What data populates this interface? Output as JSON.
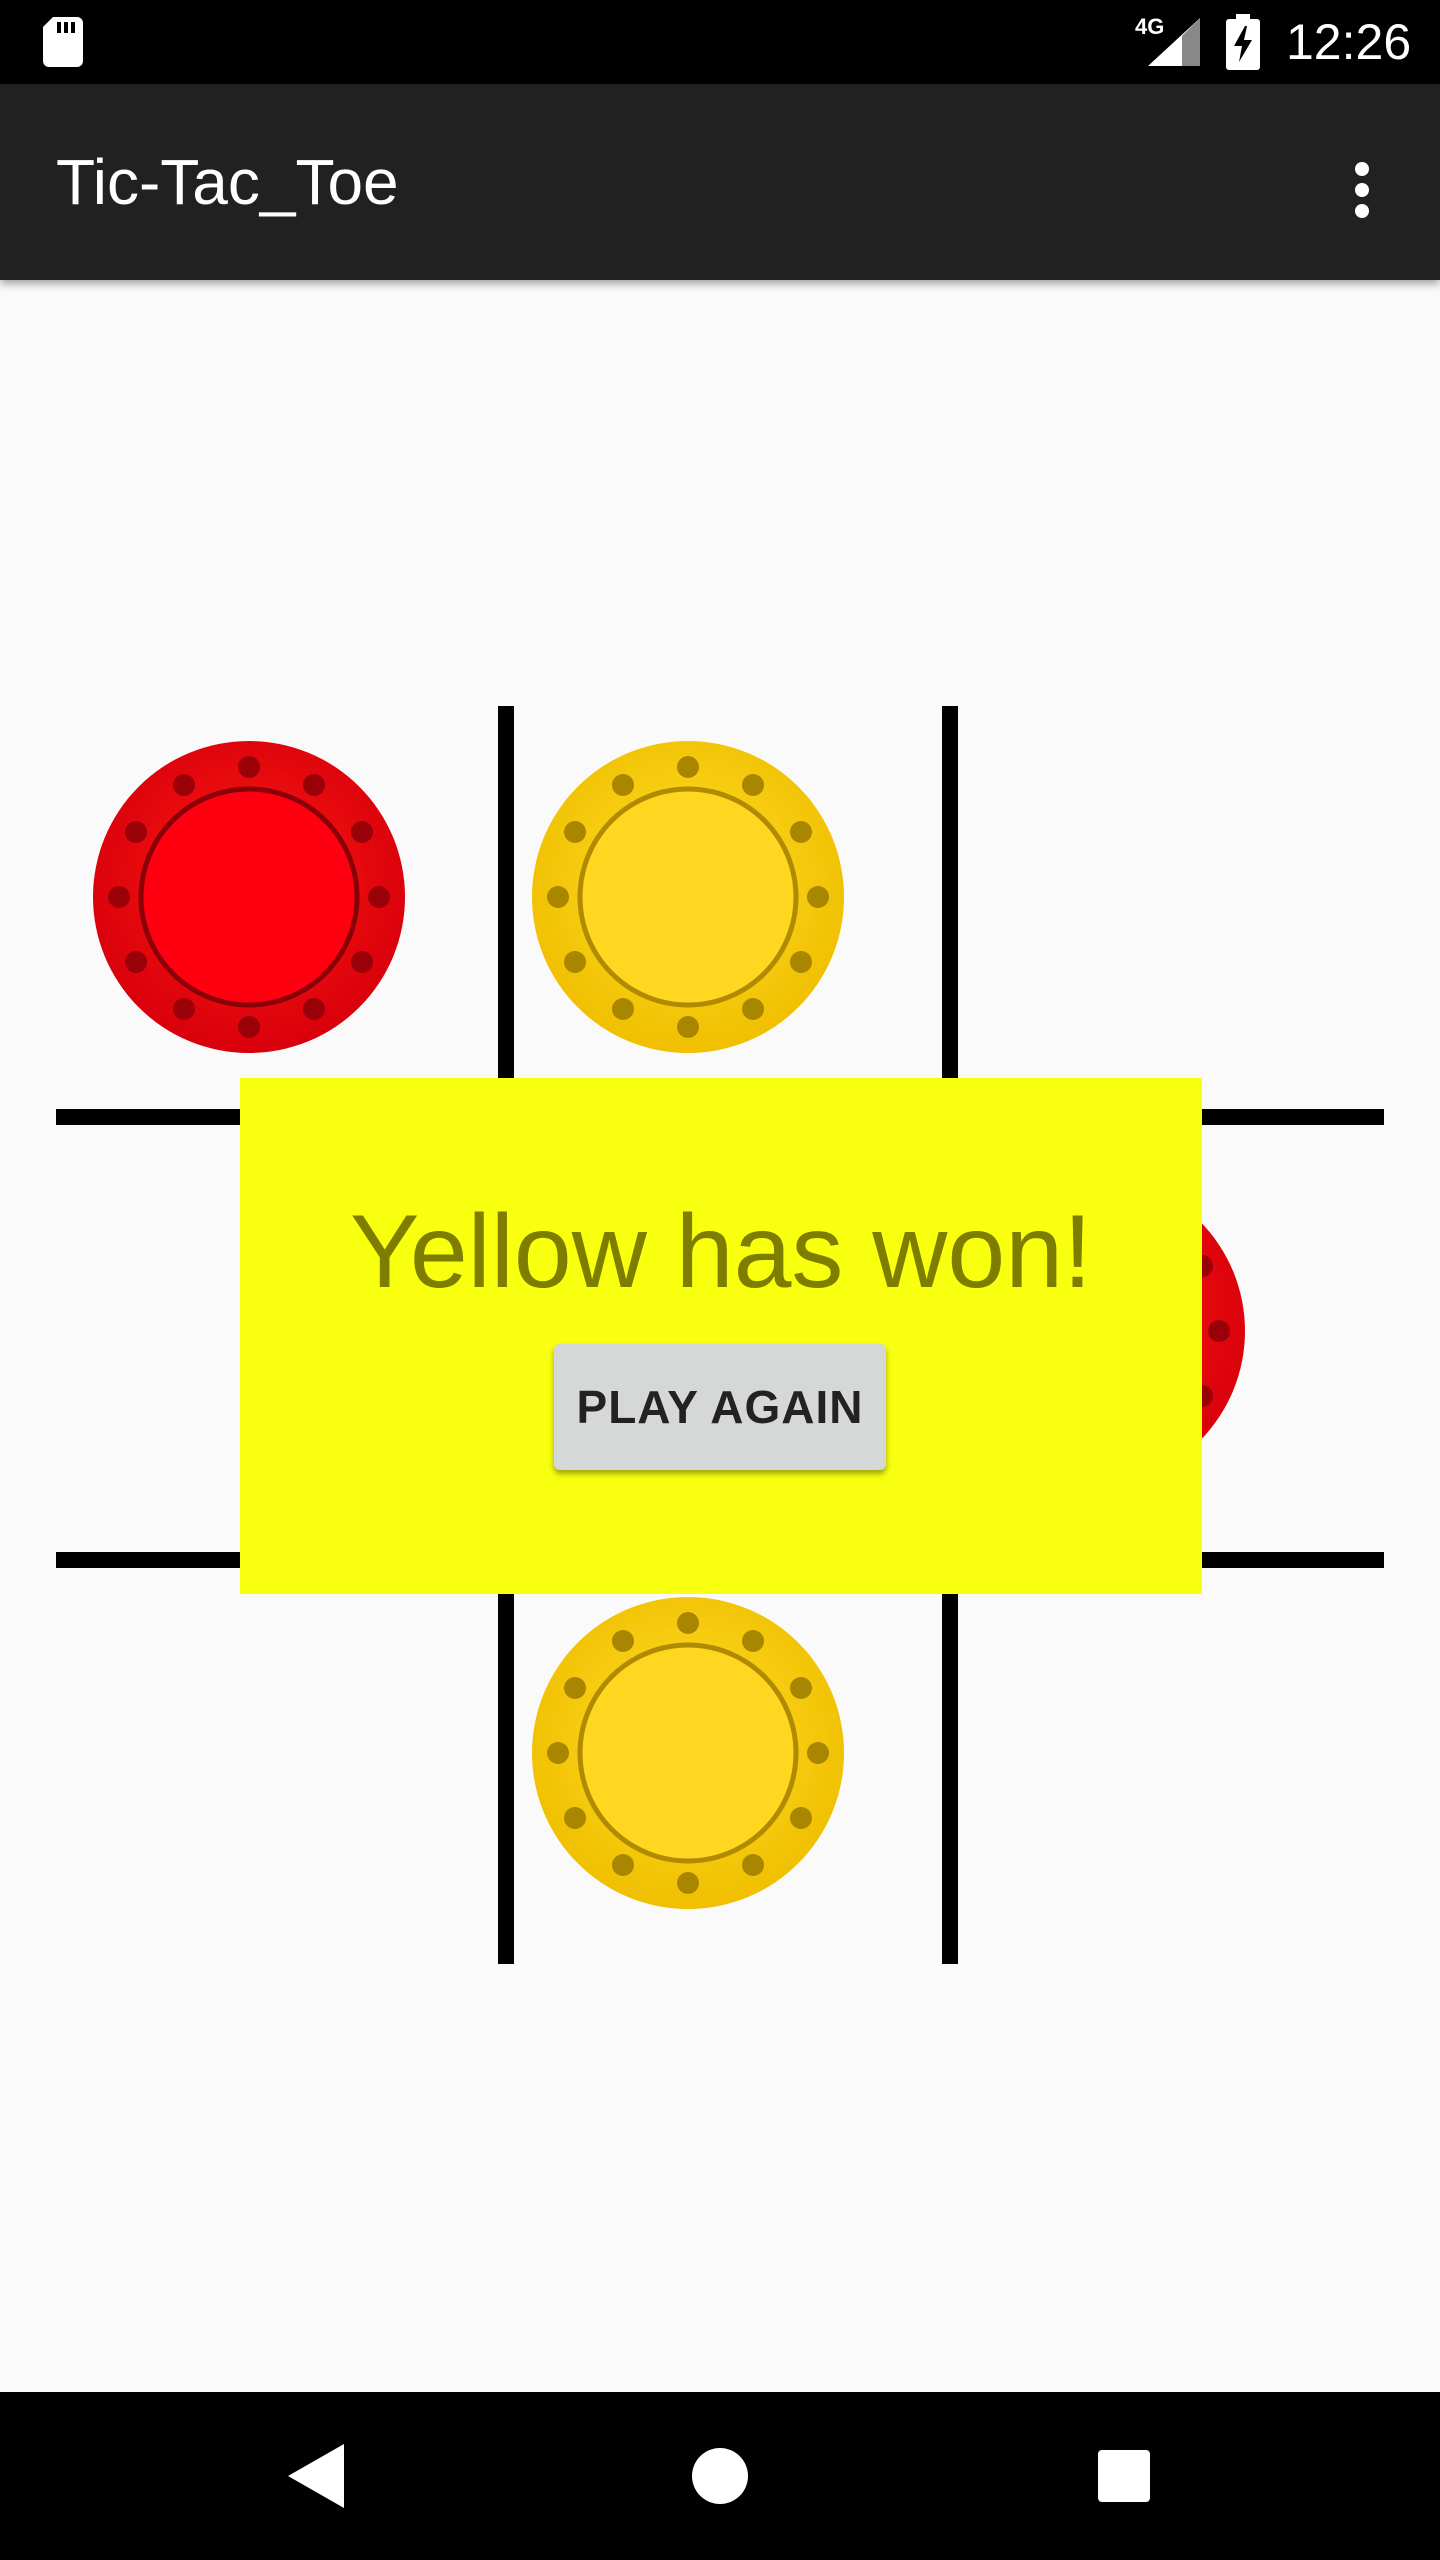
{
  "status_bar": {
    "network": "4G",
    "time": "12:26",
    "icons": [
      "sd-card-icon",
      "signal-icon",
      "battery-charging-icon"
    ]
  },
  "app_bar": {
    "title": "Tic-Tac_Toe",
    "overflow_icon": "more-vert-icon"
  },
  "board": {
    "cells": [
      "red",
      "yellow",
      "",
      "",
      "",
      "red",
      "",
      "yellow",
      ""
    ],
    "colors": {
      "red": "#e3000f",
      "yellow": "#f5c400",
      "line": "#000000"
    }
  },
  "dialog": {
    "message": "Yellow has won!",
    "button_label": "PLAY AGAIN",
    "background": "#f8ff0f"
  },
  "nav_bar": {
    "icons": [
      "back-icon",
      "home-icon",
      "recents-icon"
    ]
  }
}
